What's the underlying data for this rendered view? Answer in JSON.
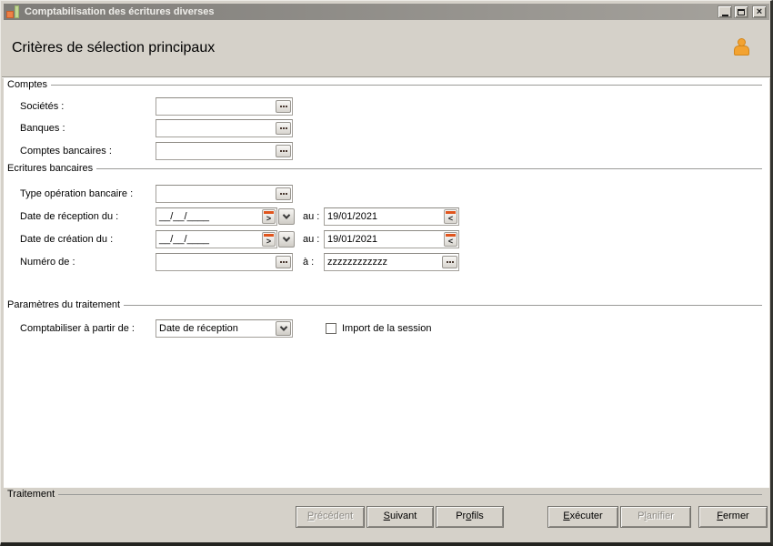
{
  "window": {
    "title": "Comptabilisation des écritures diverses"
  },
  "header": {
    "title": "Critères de sélection principaux"
  },
  "groups": {
    "comptes": "Comptes",
    "ecritures": "Ecritures bancaires",
    "parametres": "Paramètres du traitement",
    "traitement": "Traitement"
  },
  "fields": {
    "societes": {
      "label": "Sociétés :",
      "value": ""
    },
    "banques": {
      "label": "Banques :",
      "value": ""
    },
    "comptes_bancaires": {
      "label": "Comptes bancaires :",
      "value": ""
    },
    "type_operation": {
      "label": "Type opération bancaire :",
      "value": ""
    },
    "date_reception": {
      "label": "Date de réception du :",
      "from": "__/__/____",
      "to_label": "au :",
      "to": "19/01/2021"
    },
    "date_creation": {
      "label": "Date de création du :",
      "from": "__/__/____",
      "to_label": "au :",
      "to": "19/01/2021"
    },
    "numero": {
      "label": "Numéro de :",
      "value": "",
      "to_label": "à :",
      "to": "zzzzzzzzzzzz"
    },
    "comptabiliser": {
      "label": "Comptabiliser à partir de :",
      "value": "Date de réception"
    },
    "import_session": {
      "label": "Import de la session",
      "checked": false
    }
  },
  "buttons": {
    "precedent": {
      "pre": "",
      "key": "P",
      "post": "récédent",
      "disabled": true
    },
    "suivant": {
      "pre": "",
      "key": "S",
      "post": "uivant",
      "disabled": false
    },
    "profils": {
      "pre": "Pr",
      "key": "o",
      "post": "fils",
      "disabled": false
    },
    "executer": {
      "pre": "",
      "key": "E",
      "post": "xécuter",
      "disabled": false
    },
    "planifier": {
      "pre": "P",
      "key": "l",
      "post": "anifier",
      "disabled": true
    },
    "fermer": {
      "pre": "",
      "key": "F",
      "post": "ermer",
      "disabled": false
    }
  },
  "colors": {
    "accent_orange": "#e0551e",
    "person_orange": "#f3a331",
    "titlebar_text": "#efeeea"
  }
}
